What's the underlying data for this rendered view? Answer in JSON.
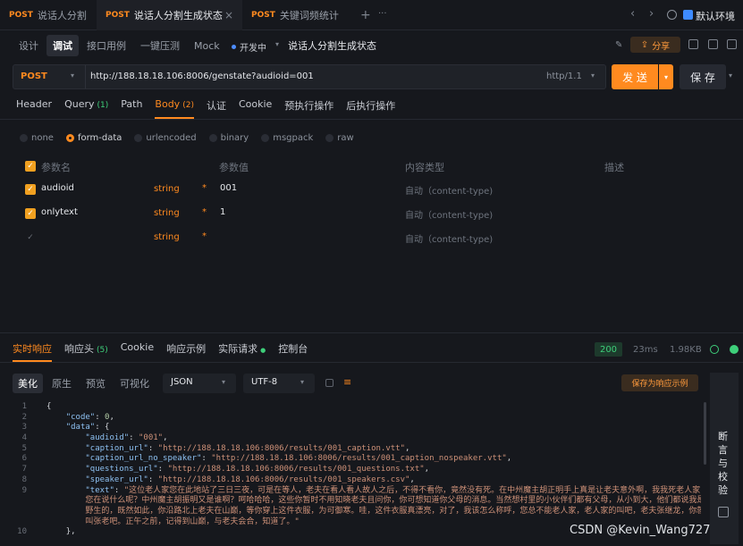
{
  "tabs": [
    {
      "method": "POST",
      "name": "说话人分割",
      "active": false
    },
    {
      "method": "POST",
      "name": "说话人分割生成状态",
      "active": true,
      "close": "×"
    },
    {
      "method": "POST",
      "name": "关键词频统计",
      "active": false
    }
  ],
  "tabbar": {
    "add": "+",
    "more": "···",
    "prev": "‹",
    "next": "›",
    "env": "默认环境"
  },
  "subnav": {
    "items": [
      "设计",
      "调试",
      "接口用例",
      "一键压测",
      "Mock"
    ],
    "active": "调试",
    "env_status": "开发中",
    "title": "说话人分割生成状态",
    "share": "分享"
  },
  "url": {
    "method": "POST",
    "value": "http://188.18.18.106:8006/genstate?audioid=001",
    "protocol": "http/1.1",
    "send": "发 送",
    "save": "保 存"
  },
  "reqtabs": [
    {
      "label": "Header"
    },
    {
      "label": "Query",
      "count": "(1)"
    },
    {
      "label": "Path"
    },
    {
      "label": "Body",
      "count": "(2)",
      "active": true
    },
    {
      "label": "认证"
    },
    {
      "label": "Cookie"
    },
    {
      "label": "预执行操作"
    },
    {
      "label": "后执行操作"
    }
  ],
  "bodytypes": [
    "none",
    "form-data",
    "urlencoded",
    "binary",
    "msgpack",
    "raw"
  ],
  "bodytype_selected": "form-data",
  "params": {
    "headers": [
      "参数名",
      "参数值",
      "内容类型",
      "描述"
    ],
    "rows": [
      {
        "name": "audioid",
        "type": "string",
        "value": "001",
        "content": "自动（content-type)",
        "checked": true
      },
      {
        "name": "onlytext",
        "type": "string",
        "value": "1",
        "content": "自动（content-type)",
        "checked": true
      },
      {
        "name": "",
        "type": "string",
        "value": "",
        "content": "自动（content-type)",
        "checked": false
      }
    ]
  },
  "resp": {
    "tabs": [
      {
        "label": "实时响应",
        "active": true
      },
      {
        "label": "响应头",
        "count": "(5)"
      },
      {
        "label": "Cookie"
      },
      {
        "label": "响应示例"
      },
      {
        "label": "实际请求",
        "dot": "●"
      },
      {
        "label": "控制台"
      }
    ],
    "status": "200",
    "time": "23ms",
    "size": "1.98KB",
    "views": [
      "美化",
      "原生",
      "预览",
      "可视化"
    ],
    "format": "JSON",
    "encoding": "UTF-8",
    "save_example": "保存为响应示例",
    "side": "断言与校验"
  },
  "json_lines": [
    {
      "n": "1",
      "html": "<span class='p'>{</span>"
    },
    {
      "n": "2",
      "html": "    <span class='k'>\"code\"</span><span class='p'>: </span><span class='n'>0</span><span class='p'>,</span>"
    },
    {
      "n": "3",
      "html": "    <span class='k'>\"data\"</span><span class='p'>: {</span>"
    },
    {
      "n": "4",
      "html": "        <span class='k'>\"audioid\"</span><span class='p'>: </span><span class='s'>\"001\"</span><span class='p'>,</span>"
    },
    {
      "n": "5",
      "html": "        <span class='k'>\"caption_url\"</span><span class='p'>: </span><span class='s'>\"http://188.18.18.106:8006/results/001_caption.vtt\"</span><span class='p'>,</span>"
    },
    {
      "n": "6",
      "html": "        <span class='k'>\"caption_url_no_speaker\"</span><span class='p'>: </span><span class='s'>\"http://188.18.18.106:8006/results/001_caption_nospeaker.vtt\"</span><span class='p'>,</span>"
    },
    {
      "n": "7",
      "html": "        <span class='k'>\"questions_url\"</span><span class='p'>: </span><span class='s'>\"http://188.18.18.106:8006/results/001_questions.txt\"</span><span class='p'>,</span>"
    },
    {
      "n": "8",
      "html": "        <span class='k'>\"speaker_url\"</span><span class='p'>: </span><span class='s'>\"http://188.18.18.106:8006/results/001_speakers.csv\"</span><span class='p'>,</span>"
    },
    {
      "n": "9",
      "html": "        <span class='k'>\"text\"</span><span class='p'>: </span><span class='s'>\"这位老人家您在此地站了三日三夜，可是在等人，老夫在看人看人故人之后，不得不看你，竟然没有死。在中州魔主胡正明手上真是让老夫意外啊，我我死老人家，</span>"
    },
    {
      "n": "",
      "html": "        <span class='s'>您在说什么呢？中州魔主胡振明又是谁啊？呵哈哈哈，这些你暂时不用知晓老夫且问你，你可想知道你父母的消息。当然想村里的小伙伴们都有父母，从小到大，他们都说我是</span>"
    },
    {
      "n": "",
      "html": "        <span class='s'>野生的，既然如此，你沿路北上老夫在山巅，等你穿上这件衣服，为可御寒。哇，这件衣服真漂亮，对了，我该怎么称呼，您总不能老人家，老人家的叫吧，老夫张继龙，你就</span>"
    },
    {
      "n": "",
      "html": "        <span class='s'>叫张老吧。正午之前，记得到山巅，与老夫会合，知道了。\"</span>"
    },
    {
      "n": "10",
      "html": "    <span class='p'>},</span>"
    }
  ],
  "watermark": "CSDN @Kevin_Wang727"
}
